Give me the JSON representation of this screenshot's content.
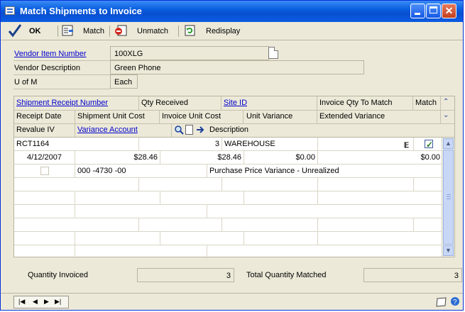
{
  "window": {
    "title": "Match Shipments to Invoice"
  },
  "toolbar": {
    "ok": "OK",
    "match": "Match",
    "unmatch": "Unmatch",
    "redisplay": "Redisplay"
  },
  "vendor": {
    "item_number_label": "Vendor Item Number",
    "item_number": "100XLG",
    "description_label": "Vendor Description",
    "description": "Green Phone",
    "uofm_label": "U of M",
    "uofm": "Each"
  },
  "header": {
    "row1": [
      "Shipment Receipt Number",
      "Qty Received",
      "Site ID",
      "Invoice Qty To Match",
      "Match"
    ],
    "row2": [
      "Receipt Date",
      "Shipment Unit Cost",
      "Invoice Unit Cost",
      "Unit Variance",
      "Extended Variance"
    ],
    "row3": [
      "Revalue IV",
      "Variance Account",
      "Description"
    ]
  },
  "grid": {
    "receipt_number": "RCT1164",
    "qty_received": "3",
    "site_id": "WAREHOUSE",
    "match_checked": true,
    "receipt_date": "4/12/2007",
    "shipment_unit_cost": "$28.46",
    "invoice_unit_cost": "$28.46",
    "unit_variance": "$0.00",
    "extended_variance": "$0.00",
    "revalue_checked": false,
    "variance_account": "000 -4730 -00",
    "account_description": "Purchase Price Variance - Unrealized"
  },
  "summary": {
    "qty_invoiced_label": "Quantity Invoiced",
    "qty_invoiced": "3",
    "total_matched_label": "Total Quantity Matched",
    "total_matched": "3"
  },
  "icons": [
    "window-icon",
    "checkmark-icon",
    "match-icon",
    "unmatch-icon",
    "redisplay-icon",
    "lookup-icon",
    "new-note-icon",
    "arrow-right-icon",
    "note-icon",
    "help-icon"
  ]
}
